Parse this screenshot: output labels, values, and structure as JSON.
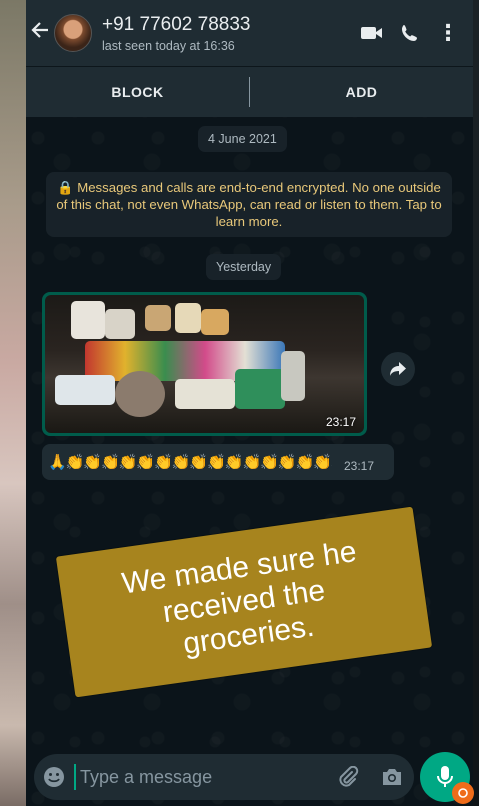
{
  "header": {
    "contact_name": "+91 77602 78833",
    "last_seen": "last seen today at 16:36",
    "icons": [
      "back-arrow-icon",
      "video-call-icon",
      "voice-call-icon",
      "more-options-icon"
    ]
  },
  "actions": {
    "block_label": "BLOCK",
    "add_label": "ADD"
  },
  "chat": {
    "date_chip": "4 June 2021",
    "encryption_notice": "🔒 Messages and calls are end-to-end encrypted. No one outside of this chat, not even WhatsApp, can read or listen to them. Tap to learn more.",
    "day_chip": "Yesterday",
    "image_message": {
      "time": "23:17"
    },
    "emoji_message": {
      "text": "🙏👏👏👏👏👏👏👏👏👏👏👏👏👏👏👏👏👏👏",
      "time": "23:17"
    }
  },
  "caption": {
    "text": "We made sure he received the groceries."
  },
  "composer": {
    "placeholder": "Type a message"
  },
  "colors": {
    "header": "#1f2c33",
    "background": "#0b141a",
    "accent": "#00a884",
    "caption_bg": "#a7841e"
  }
}
